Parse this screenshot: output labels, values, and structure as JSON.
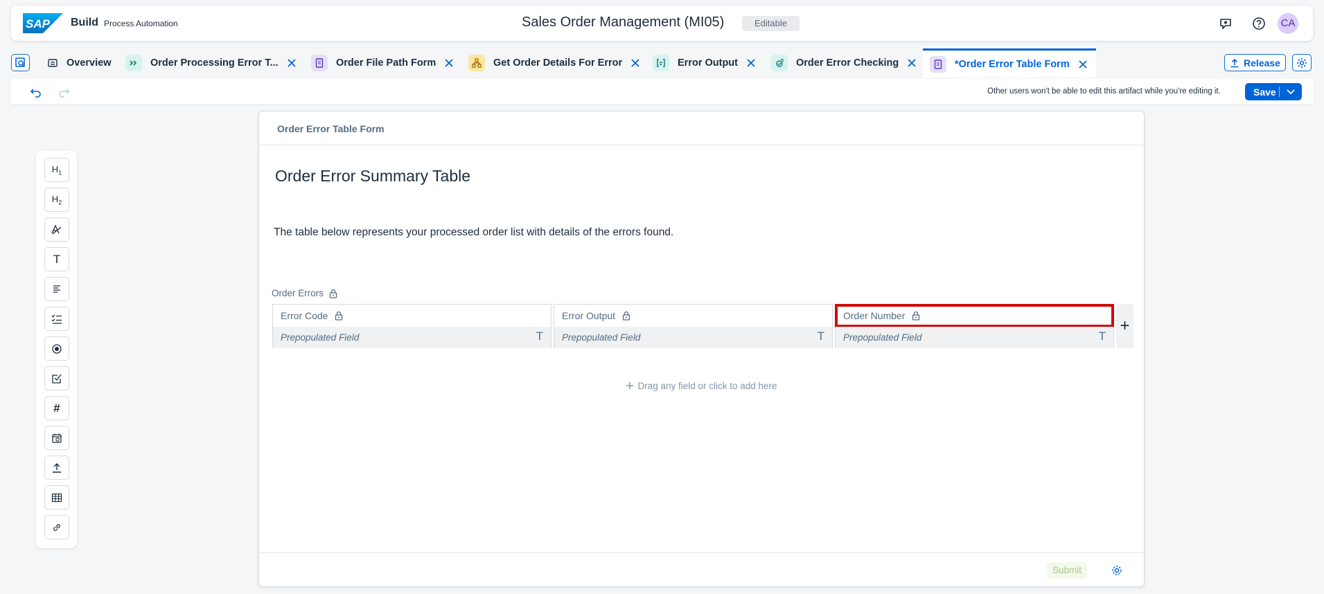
{
  "shell": {
    "logo_text": "SAP",
    "brand": "Build",
    "product": "Process Automation",
    "title": "Sales Order Management (MI05)",
    "status_badge": "Editable",
    "avatar_initials": "CA",
    "icons": [
      "feedback-icon",
      "help-icon"
    ]
  },
  "tabs": [
    {
      "label": "Overview",
      "icon": "overview-icon",
      "closable": false,
      "active": false
    },
    {
      "label": "Order Processing Error T...",
      "icon": "process-icon",
      "closable": true,
      "active": false
    },
    {
      "label": "Order File Path Form",
      "icon": "form-icon",
      "closable": true,
      "active": false
    },
    {
      "label": "Get Order Details For Error",
      "icon": "decision-icon",
      "closable": true,
      "active": false
    },
    {
      "label": "Error Output",
      "icon": "output-icon",
      "closable": true,
      "active": false
    },
    {
      "label": "Order Error Checking",
      "icon": "automation-icon",
      "closable": true,
      "active": false
    },
    {
      "label": "*Order Error Table Form",
      "icon": "form-icon",
      "closable": true,
      "active": true
    }
  ],
  "actions": {
    "release_label": "Release",
    "save_label": "Save"
  },
  "toolbar": {
    "edit_message": "Other users won't be able to edit this artifact while you're editing it."
  },
  "palette": {
    "items": [
      {
        "name": "heading1",
        "label": "H1"
      },
      {
        "name": "heading2",
        "label": "H2"
      },
      {
        "name": "text-style",
        "label": "A"
      },
      {
        "name": "text-input",
        "label": "T"
      },
      {
        "name": "paragraph",
        "label": ""
      },
      {
        "name": "checklist",
        "label": ""
      },
      {
        "name": "radio",
        "label": ""
      },
      {
        "name": "checkbox",
        "label": ""
      },
      {
        "name": "number",
        "label": "#"
      },
      {
        "name": "date",
        "label": ""
      },
      {
        "name": "upload",
        "label": ""
      },
      {
        "name": "table",
        "label": ""
      },
      {
        "name": "link",
        "label": ""
      }
    ]
  },
  "form": {
    "header": "Order Error Table Form",
    "title": "Order Error Summary Table",
    "description": "The table below represents your processed order list with details of the errors found.",
    "table_label": "Order Errors",
    "columns": [
      {
        "header": "Error Code",
        "placeholder": "Prepopulated Field",
        "type_glyph": "T"
      },
      {
        "header": "Error Output",
        "placeholder": "Prepopulated Field",
        "type_glyph": "T"
      },
      {
        "header": "Order Number",
        "placeholder": "Prepopulated Field",
        "type_glyph": "T"
      }
    ],
    "add_column_glyph": "+",
    "drop_hint": "Drag any field or click to add here",
    "submit_label": "Submit"
  },
  "colors": {
    "accent": "#0064d9",
    "selection": "#d20a0a"
  }
}
